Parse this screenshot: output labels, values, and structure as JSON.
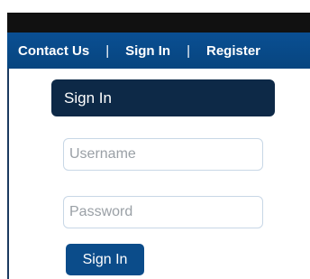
{
  "nav": {
    "contact_label": "Contact Us",
    "separator": "|",
    "signin_label": "Sign In",
    "register_label": "Register"
  },
  "panel": {
    "title": "Sign In"
  },
  "form": {
    "username_placeholder": "Username",
    "password_placeholder": "Password",
    "submit_label": "Sign In"
  },
  "colors": {
    "nav_blue": "#0a4f93",
    "panel_navy": "#0d2947",
    "button_blue": "#0b4c8a"
  }
}
